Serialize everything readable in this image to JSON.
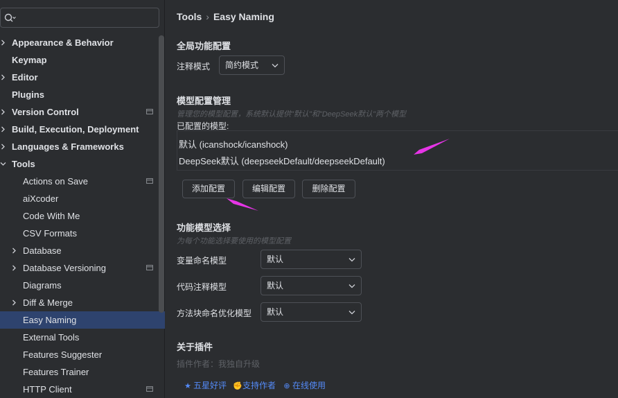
{
  "search": {
    "value": "",
    "placeholder": ""
  },
  "sidebar": {
    "items": [
      {
        "label": "Appearance & Behavior",
        "level": 0,
        "expandable": true,
        "expanded": false,
        "project": false,
        "selected": false
      },
      {
        "label": "Keymap",
        "level": 0,
        "expandable": false,
        "project": false,
        "selected": false
      },
      {
        "label": "Editor",
        "level": 0,
        "expandable": true,
        "expanded": false,
        "project": false,
        "selected": false
      },
      {
        "label": "Plugins",
        "level": 0,
        "expandable": false,
        "project": false,
        "selected": false
      },
      {
        "label": "Version Control",
        "level": 0,
        "expandable": true,
        "expanded": false,
        "project": true,
        "selected": false
      },
      {
        "label": "Build, Execution, Deployment",
        "level": 0,
        "expandable": true,
        "expanded": false,
        "project": false,
        "selected": false
      },
      {
        "label": "Languages & Frameworks",
        "level": 0,
        "expandable": true,
        "expanded": false,
        "project": false,
        "selected": false
      },
      {
        "label": "Tools",
        "level": 0,
        "expandable": true,
        "expanded": true,
        "project": false,
        "selected": false
      },
      {
        "label": "Actions on Save",
        "level": 1,
        "expandable": false,
        "project": true,
        "selected": false
      },
      {
        "label": "aiXcoder",
        "level": 1,
        "expandable": false,
        "project": false,
        "selected": false
      },
      {
        "label": "Code With Me",
        "level": 1,
        "expandable": false,
        "project": false,
        "selected": false
      },
      {
        "label": "CSV Formats",
        "level": 1,
        "expandable": false,
        "project": false,
        "selected": false
      },
      {
        "label": "Database",
        "level": 1,
        "expandable": true,
        "expanded": false,
        "project": false,
        "selected": false
      },
      {
        "label": "Database Versioning",
        "level": 1,
        "expandable": true,
        "expanded": false,
        "project": true,
        "selected": false
      },
      {
        "label": "Diagrams",
        "level": 1,
        "expandable": false,
        "project": false,
        "selected": false
      },
      {
        "label": "Diff & Merge",
        "level": 1,
        "expandable": true,
        "expanded": false,
        "project": false,
        "selected": false
      },
      {
        "label": "Easy Naming",
        "level": 1,
        "expandable": false,
        "project": false,
        "selected": true
      },
      {
        "label": "External Tools",
        "level": 1,
        "expandable": false,
        "project": false,
        "selected": false
      },
      {
        "label": "Features Suggester",
        "level": 1,
        "expandable": false,
        "project": false,
        "selected": false
      },
      {
        "label": "Features Trainer",
        "level": 1,
        "expandable": false,
        "project": false,
        "selected": false
      },
      {
        "label": "HTTP Client",
        "level": 1,
        "expandable": false,
        "project": true,
        "selected": false
      }
    ]
  },
  "breadcrumb": {
    "parent": "Tools",
    "separator": "›",
    "current": "Easy Naming"
  },
  "global": {
    "title": "全局功能配置",
    "comment_mode_label": "注释模式",
    "comment_mode_value": "简约模式"
  },
  "models": {
    "title": "模型配置管理",
    "hint": "管理您的模型配置，系统默认提供\"默认\"和\"DeepSeek默认\"两个模型",
    "configured_label": "已配置的模型:",
    "list": [
      "默认 (icanshock/icanshock)",
      "DeepSeek默认 (deepseekDefault/deepseekDefault)"
    ],
    "add_button": "添加配置",
    "edit_button": "编辑配置",
    "delete_button": "删除配置"
  },
  "feature": {
    "title": "功能模型选择",
    "hint": "为每个功能选择要使用的模型配置",
    "rows": [
      {
        "label": "变量命名模型",
        "value": "默认"
      },
      {
        "label": "代码注释模型",
        "value": "默认"
      },
      {
        "label": "方法块命名优化模型",
        "value": "默认"
      }
    ]
  },
  "about": {
    "title": "关于插件",
    "author": "插件作者：我独自升级",
    "links": [
      {
        "icon": "star-icon",
        "glyph": "★",
        "label": "五星好评"
      },
      {
        "icon": "thumb-icon",
        "glyph": "✊",
        "label": "支持作者"
      },
      {
        "icon": "globe-icon",
        "glyph": "⊕",
        "label": "在线使用"
      }
    ]
  },
  "colors": {
    "background": "#2b2d30",
    "selection": "#2e436e",
    "link": "#548af7",
    "annotation": "#e635e6"
  }
}
